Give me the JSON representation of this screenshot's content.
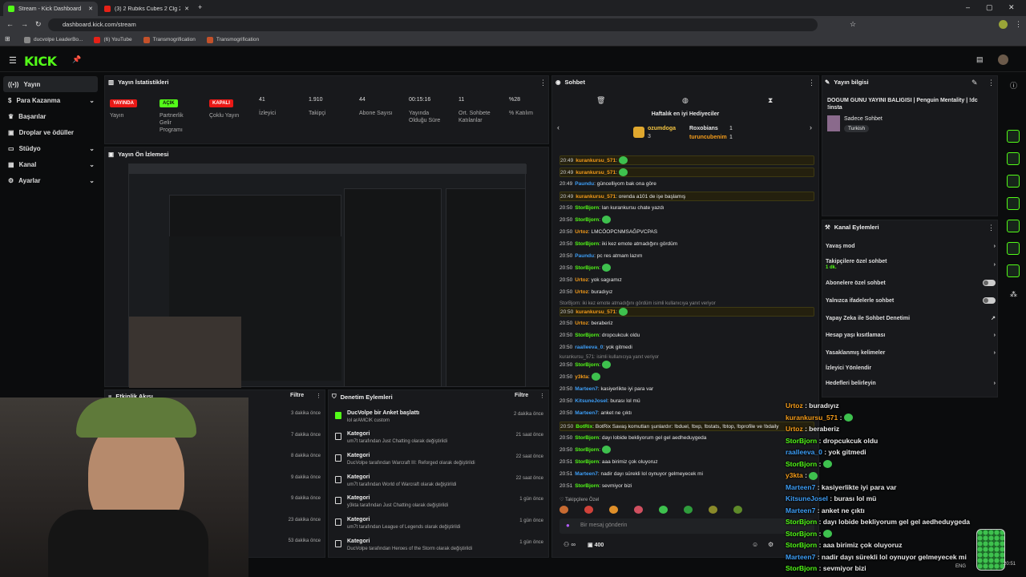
{
  "browser": {
    "tabs": [
      {
        "title": "Stream - Kick Dashboard"
      },
      {
        "title": "(3) 2 Rubiks Cubes 2 Clg 2 Bes"
      }
    ],
    "url": "dashboard.kick.com/stream",
    "bookmarks": [
      "ducvolpe LeaderBo...",
      "(6) YouTube",
      "Transmogrification",
      "Transmogrification"
    ]
  },
  "app": {
    "logo": "KICK"
  },
  "sidebar": [
    {
      "label": "Yayın",
      "icon": "stream-icon"
    },
    {
      "label": "Para Kazanma",
      "icon": "dollar-icon"
    },
    {
      "label": "Başarılar",
      "icon": "trophy-icon"
    },
    {
      "label": "Droplar ve ödüller",
      "icon": "gift-icon"
    },
    {
      "label": "Stüdyo",
      "icon": "studio-icon"
    },
    {
      "label": "Kanal",
      "icon": "channel-icon"
    },
    {
      "label": "Ayarlar",
      "icon": "settings-icon"
    }
  ],
  "stats": {
    "title": "Yayın İstatistikleri",
    "items": [
      {
        "value": "YAYINDA",
        "label": "Yayın",
        "badge": "#e91916"
      },
      {
        "value": "AÇIK",
        "label": "Partnerlik Gelir Programı",
        "badge": "#53fc18"
      },
      {
        "value": "KAPALI",
        "label": "Çoklu Yayın",
        "badge": "#e91916"
      },
      {
        "value": "41",
        "label": "İzleyici"
      },
      {
        "value": "1.910",
        "label": "Takipçi"
      },
      {
        "value": "44",
        "label": "Abone Sayısı"
      },
      {
        "value": "00:15:16",
        "label": "Yayında Olduğu Süre"
      },
      {
        "value": "11",
        "label": "Ort. Sohbete Katılanlar"
      },
      {
        "value": "%28",
        "label": "% Katılım"
      }
    ]
  },
  "preview": {
    "title": "Yayın Ön İzlemesi"
  },
  "activity": {
    "title": "Etkinlik Akışı",
    "filter": "Filtre",
    "times": [
      "3 dakika önce",
      "7 dakika önce",
      "8 dakika önce",
      "9 dakika önce",
      "9 dakika önce",
      "23 dakika önce",
      "53 dakika önce"
    ]
  },
  "moderation": {
    "title": "Denetim Eylemleri",
    "filter": "Filtre",
    "rows": [
      {
        "head": "DucVolpe bir Anket başlattı",
        "sub": "lol arAMCIK custom",
        "time": "2 dakika önce"
      },
      {
        "head": "Kategori",
        "sub": "um7t tarafından Just Chatting olarak değiştirildi",
        "time": "21 saat önce"
      },
      {
        "head": "Kategori",
        "sub": "DucVolpe tarafından Warcraft III: Reforged olarak değiştirildi",
        "time": "22 saat önce"
      },
      {
        "head": "Kategori",
        "sub": "um7t tarafından World of Warcraft olarak değiştirildi",
        "time": "22 saat önce"
      },
      {
        "head": "Kategori",
        "sub": "y3kta tarafından Just Chatting olarak değiştirildi",
        "time": "1 gün önce"
      },
      {
        "head": "Kategori",
        "sub": "um7t tarafından League of Legends olarak değiştirildi",
        "time": "1 gün önce"
      },
      {
        "head": "Kategori",
        "sub": "DucVolpe tarafından Heroes of the Storm olarak değiştirildi",
        "time": "1 gün önce"
      }
    ]
  },
  "chat": {
    "title": "Sohbet",
    "gifters_title": "Haftalık en iyi Hediyeciler",
    "gifters": [
      {
        "name": "ozumdoga",
        "count": "3"
      },
      {
        "name": "Roxobians",
        "count": "1"
      },
      {
        "name": "turuncubenim",
        "count": "1"
      }
    ],
    "messages": [
      {
        "time": "20:49",
        "user": "kurankursu_571",
        "text": "",
        "hl": true,
        "uc": "ulo"
      },
      {
        "time": "20:49",
        "user": "kurankursu_571",
        "text": "",
        "hl": true,
        "uc": "ulo"
      },
      {
        "time": "20:49",
        "user": "Paundu",
        "text": "güncelliyom bak ona göre",
        "hl": false,
        "uc": "ubl"
      },
      {
        "time": "20:49",
        "user": "kurankursu_571",
        "text": "orenda a101 de işe başlamış",
        "hl": true,
        "uc": "ulo"
      },
      {
        "time": "20:50",
        "user": "StorBjorn",
        "text": "lan kurankursu chate yazdı",
        "hl": false,
        "uc": "ugr"
      },
      {
        "time": "20:50",
        "user": "StorBjorn",
        "text": "",
        "hl": false,
        "uc": "ugr"
      },
      {
        "time": "20:50",
        "user": "Urtoz",
        "text": "LMCÖOPCNMSAĞPVCPAS",
        "hl": false,
        "uc": "ulo"
      },
      {
        "time": "20:50",
        "user": "StorBjorn",
        "text": "iki kez emote atmadığını gördüm",
        "hl": false,
        "uc": "ugr"
      },
      {
        "time": "20:50",
        "user": "Paundu",
        "text": "pc res atmam lazım",
        "hl": false,
        "uc": "ubl"
      },
      {
        "time": "20:50",
        "user": "StorBjorn",
        "text": "",
        "hl": false,
        "uc": "ugr"
      },
      {
        "time": "20:50",
        "user": "Urtoz",
        "text": "yok sagıamız",
        "hl": false,
        "uc": "ulo"
      },
      {
        "time": "20:50",
        "user": "Urtoz",
        "text": "buradıyız",
        "hl": false,
        "uc": "ulo"
      },
      {
        "time": "20:50",
        "user": "kurankursu_571",
        "text": "",
        "hl": true,
        "uc": "ulo"
      },
      {
        "time": "20:50",
        "user": "Urtoz",
        "text": "beraberiz",
        "hl": false,
        "uc": "ulo"
      },
      {
        "time": "20:50",
        "user": "StorBjorn",
        "text": "dropcukcuk oldu",
        "hl": false,
        "uc": "ugr"
      },
      {
        "time": "20:50",
        "user": "raalleeva_0",
        "text": "yok gitmedi",
        "hl": false,
        "uc": "ubl"
      },
      {
        "time": "20:50",
        "user": "StorBjorn",
        "text": "",
        "hl": false,
        "uc": "ugr"
      },
      {
        "time": "20:50",
        "user": "y3kta",
        "text": "",
        "hl": false,
        "uc": "ulo"
      },
      {
        "time": "20:50",
        "user": "Marteen7",
        "text": "kasiyerlikte iyi para var",
        "hl": false,
        "uc": "ubl"
      },
      {
        "time": "20:50",
        "user": "KitsuneJosel",
        "text": "burası lol mü",
        "hl": false,
        "uc": "ubl"
      },
      {
        "time": "20:50",
        "user": "Marteen7",
        "text": "anket ne çıktı",
        "hl": false,
        "uc": "ubl"
      },
      {
        "time": "20:50",
        "user": "BotRix",
        "text": "BotRix Savaş komutları şunlardır: !bduel, !bxp, !bstats, !btop, !bprofile ve !bdaily",
        "hl": true,
        "uc": "ugr"
      },
      {
        "time": "20:50",
        "user": "StorBjorn",
        "text": "dayı lobide bekliyorum gel gel aedheduygeda",
        "hl": false,
        "uc": "ugr"
      },
      {
        "time": "20:50",
        "user": "StorBjorn",
        "text": "",
        "hl": false,
        "uc": "ugr"
      },
      {
        "time": "20:51",
        "user": "StorBjorn",
        "text": "aaa birimiz çok oluyoruz",
        "hl": false,
        "uc": "ugr"
      },
      {
        "time": "20:51",
        "user": "Marteen7",
        "text": "nadir dayı sürekli lol oynuyor gelmeyecek mi",
        "hl": false,
        "uc": "ubl"
      },
      {
        "time": "20:51",
        "user": "StorBjorn",
        "text": "sevmiyor bizi",
        "hl": false,
        "uc": "ugr"
      }
    ],
    "reply1": "StorBjorn: iki kez emote atmadığını gördüm isimli kullanıcıya yanıt veriyor",
    "reply2": "kurankursu_571: isimli kullanıcıya yanıt veriyor",
    "followers_only": "Takipçilere Özel",
    "input_placeholder": "Bir mesaj gönderin",
    "points": "400"
  },
  "info": {
    "title": "Yayın bilgisi",
    "stream_title": "DOGUM GUNU YAYINI BALIGISI | Penguin Mentality | !dc !insta",
    "category": "Sadece Sohbet",
    "language": "Turkish"
  },
  "channel_actions": {
    "title": "Kanal Eylemleri",
    "items": [
      {
        "label": "Yavaş mod",
        "control": "chevron"
      },
      {
        "label": "Takipçilere özel sohbet",
        "sub": "1 dk.",
        "control": "chevron"
      },
      {
        "label": "Abonelere özel sohbet",
        "control": "toggle"
      },
      {
        "label": "Yalnızca ifadelerle sohbet",
        "control": "toggle"
      },
      {
        "label": "Yapay Zeka ile Sohbet Denetimi",
        "control": "external"
      },
      {
        "label": "Hesap yaşı kısıtlaması",
        "control": "chevron"
      },
      {
        "label": "Yasaklanmış kelimeler",
        "control": "chevron"
      },
      {
        "label": "İzleyici Yönlendir",
        "control": "none"
      },
      {
        "label": "Hedefleri belirleyin",
        "control": "chevron"
      }
    ]
  },
  "overlay_chat": [
    {
      "user": "Urtoz",
      "text": "buradıyız",
      "uc": "ulo"
    },
    {
      "user": "kurankursu_571",
      "text": "",
      "uc": "ulo"
    },
    {
      "user": "Urtoz",
      "text": "beraberiz",
      "uc": "ulo"
    },
    {
      "user": "StorBjorn",
      "text": "dropcukcuk oldu",
      "uc": "ugr"
    },
    {
      "user": "raalleeva_0",
      "text": "yok gitmedi",
      "uc": "ubl"
    },
    {
      "user": "StorBjorn",
      "text": "",
      "uc": "ugr"
    },
    {
      "user": "y3kta",
      "text": "",
      "uc": "ulo"
    },
    {
      "user": "Marteen7",
      "text": "kasiyerlikte iyi para var",
      "uc": "ubl"
    },
    {
      "user": "KitsuneJosel",
      "text": "burası lol mü",
      "uc": "ubl"
    },
    {
      "user": "Marteen7",
      "text": "anket ne çıktı",
      "uc": "ubl"
    },
    {
      "user": "StorBjorn",
      "text": "dayı lobide bekliyorum gel gel aedheduygeda",
      "uc": "ugr"
    },
    {
      "user": "StorBjorn",
      "text": "",
      "uc": "ugr"
    },
    {
      "user": "StorBjorn",
      "text": "aaa birimiz çok oluyoruz",
      "uc": "ugr"
    },
    {
      "user": "Marteen7",
      "text": "nadir dayı sürekli lol oynuyor gelmeyecek mi",
      "uc": "ubl"
    },
    {
      "user": "StorBjorn",
      "text": "sevmiyor bizi",
      "uc": "ugr"
    }
  ],
  "taskbar": {
    "lang": "ENG",
    "time": "20:51"
  },
  "colors": {
    "accent": "#53fc18",
    "live": "#e91916",
    "panel": "#18191c"
  }
}
